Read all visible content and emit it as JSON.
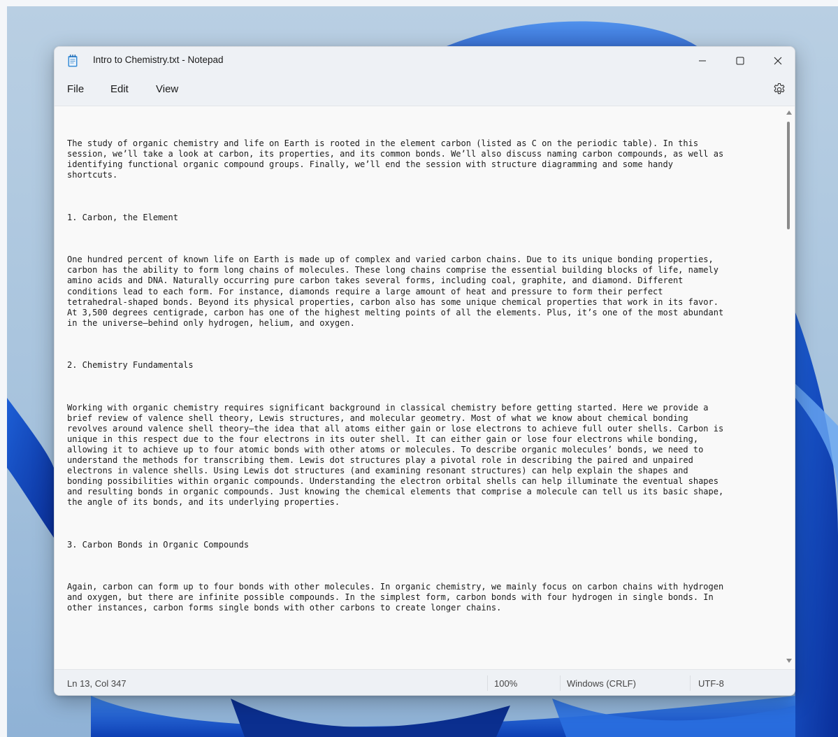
{
  "window": {
    "title": "Intro to Chemistry.txt - Notepad",
    "app_icon": "notepad-icon",
    "controls": [
      "minimize-icon",
      "maximize-icon",
      "close-icon"
    ]
  },
  "menu": {
    "file": "File",
    "edit": "Edit",
    "view": "View",
    "settings_icon": "gear-icon"
  },
  "document": {
    "paragraphs": [
      "The study of organic chemistry and life on Earth is rooted in the element carbon (listed as C on the periodic table). In this\nsession, we’ll take a look at carbon, its properties, and its common bonds. We’ll also discuss naming carbon compounds, as well as\nidentifying functional organic compound groups. Finally, we’ll end the session with structure diagramming and some handy\nshortcuts.",
      "1. Carbon, the Element",
      "One hundred percent of known life on Earth is made up of complex and varied carbon chains. Due to its unique bonding properties,\ncarbon has the ability to form long chains of molecules. These long chains comprise the essential building blocks of life, namely\namino acids and DNA. Naturally occurring pure carbon takes several forms, including coal, graphite, and diamond. Different\nconditions lead to each form. For instance, diamonds require a large amount of heat and pressure to form their perfect\ntetrahedral-shaped bonds. Beyond its physical properties, carbon also has some unique chemical properties that work in its favor.\nAt 3,500 degrees centigrade, carbon has one of the highest melting points of all the elements. Plus, it’s one of the most abundant\nin the universe—behind only hydrogen, helium, and oxygen.",
      "2. Chemistry Fundamentals",
      "Working with organic chemistry requires significant background in classical chemistry before getting started. Here we provide a\nbrief review of valence shell theory, Lewis structures, and molecular geometry. Most of what we know about chemical bonding\nrevolves around valence shell theory—the idea that all atoms either gain or lose electrons to achieve full outer shells. Carbon is\nunique in this respect due to the four electrons in its outer shell. It can either gain or lose four electrons while bonding,\nallowing it to achieve up to four atomic bonds with other atoms or molecules. To describe organic molecules’ bonds, we need to\nunderstand the methods for transcribing them. Lewis dot structures play a pivotal role in describing the paired and unpaired\nelectrons in valence shells. Using Lewis dot structures (and examining resonant structures) can help explain the shapes and\nbonding possibilities within organic compounds. Understanding the electron orbital shells can help illuminate the eventual shapes\nand resulting bonds in organic compounds. Just knowing the chemical elements that comprise a molecule can tell us its basic shape,\nthe angle of its bonds, and its underlying properties.",
      "3. Carbon Bonds in Organic Compounds",
      "Again, carbon can form up to four bonds with other molecules. In organic chemistry, we mainly focus on carbon chains with hydrogen\nand oxygen, but there are infinite possible compounds. In the simplest form, carbon bonds with four hydrogen in single bonds. In\nother instances, carbon forms single bonds with other carbons to create longer chains."
    ]
  },
  "status": {
    "position": "Ln 13, Col 347",
    "zoom": "100%",
    "line_ending": "Windows (CRLF)",
    "encoding": "UTF-8"
  }
}
